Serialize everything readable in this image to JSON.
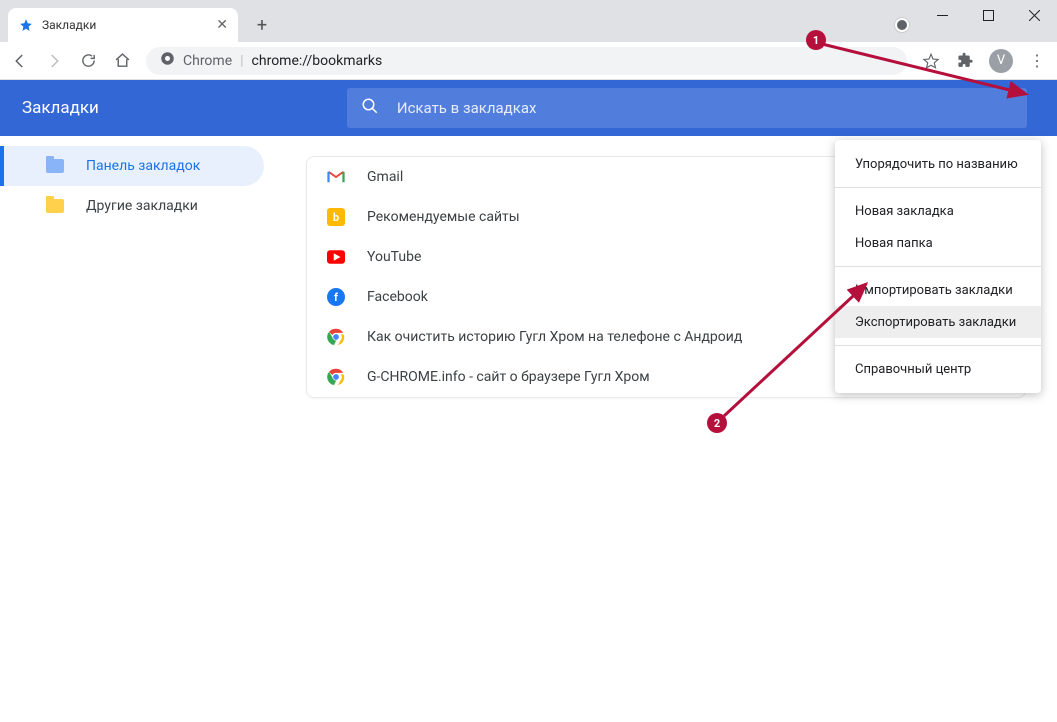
{
  "tab": {
    "title": "Закладки"
  },
  "address": {
    "chrome_label": "Chrome",
    "url": "chrome://bookmarks"
  },
  "avatar_letter": "V",
  "header": {
    "title": "Закладки",
    "search_placeholder": "Искать в закладках"
  },
  "sidebar": {
    "items": [
      {
        "label": "Панель закладок"
      },
      {
        "label": "Другие закладки"
      }
    ]
  },
  "bookmarks": [
    {
      "label": "Gmail",
      "icon": "gmail"
    },
    {
      "label": "Рекомендуемые сайты",
      "icon": "bing"
    },
    {
      "label": "YouTube",
      "icon": "youtube"
    },
    {
      "label": "Facebook",
      "icon": "facebook"
    },
    {
      "label": "Как очистить историю Гугл Хром на телефоне с Андроид",
      "icon": "chrome"
    },
    {
      "label": "G-CHROME.info - сайт о браузере Гугл Хром",
      "icon": "chrome"
    }
  ],
  "menu": {
    "items": [
      {
        "label": "Упорядочить по названию"
      },
      {
        "label": "Новая закладка"
      },
      {
        "label": "Новая папка"
      },
      {
        "label": "Импортировать закладки"
      },
      {
        "label": "Экспортировать закладки"
      },
      {
        "label": "Справочный центр"
      }
    ]
  },
  "annotations": {
    "step1": "1",
    "step2": "2"
  }
}
